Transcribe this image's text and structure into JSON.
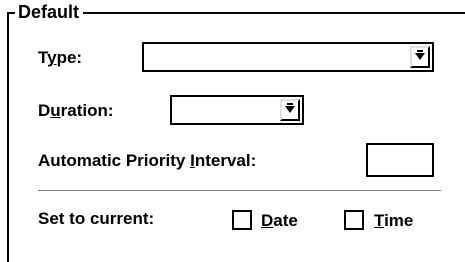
{
  "group": {
    "title": "Default"
  },
  "type_field": {
    "label_pre": "T",
    "label_mn": "y",
    "label_post": "pe:",
    "value": ""
  },
  "duration_field": {
    "label_pre": "D",
    "label_mn": "u",
    "label_post": "ration:",
    "value": ""
  },
  "api_field": {
    "label_pre": "Automatic Priority ",
    "label_mn": "I",
    "label_post": "nterval:",
    "value": ""
  },
  "set_current": {
    "label": "Set to current:",
    "date": {
      "label_mn": "D",
      "label_post": "ate",
      "checked": false
    },
    "time": {
      "label_mn": "T",
      "label_post": "ime",
      "checked": false
    }
  },
  "icons": {
    "dropdown": "down-arrow-to-line-icon"
  }
}
